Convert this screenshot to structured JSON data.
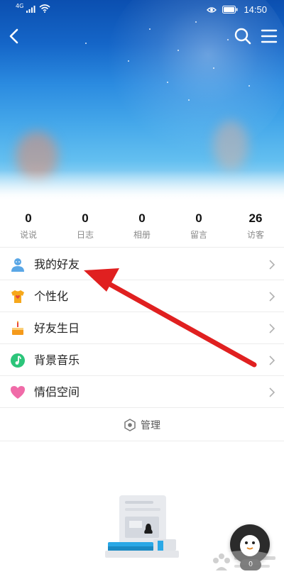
{
  "status_bar": {
    "network": "4G",
    "time": "14:50"
  },
  "stats": [
    {
      "value": "0",
      "label": "说说"
    },
    {
      "value": "0",
      "label": "日志"
    },
    {
      "value": "0",
      "label": "相册"
    },
    {
      "value": "0",
      "label": "留言"
    },
    {
      "value": "26",
      "label": "访客"
    }
  ],
  "menu": {
    "items": [
      {
        "label": "我的好友",
        "icon": "friends-icon",
        "color": "#5aa7e6"
      },
      {
        "label": "个性化",
        "icon": "tshirt-icon",
        "color": "#f6a81c"
      },
      {
        "label": "好友生日",
        "icon": "birthday-cake-icon",
        "color": "#f59a1b"
      },
      {
        "label": "背景音乐",
        "icon": "music-note-icon",
        "color": "#2cc57a"
      },
      {
        "label": "情侣空间",
        "icon": "heart-icon",
        "color": "#f06ba8"
      }
    ],
    "manage_label": "管理"
  },
  "fab": {
    "badge": "0"
  },
  "colors": {
    "annotation_arrow": "#e02020",
    "divider": "#ececec"
  }
}
